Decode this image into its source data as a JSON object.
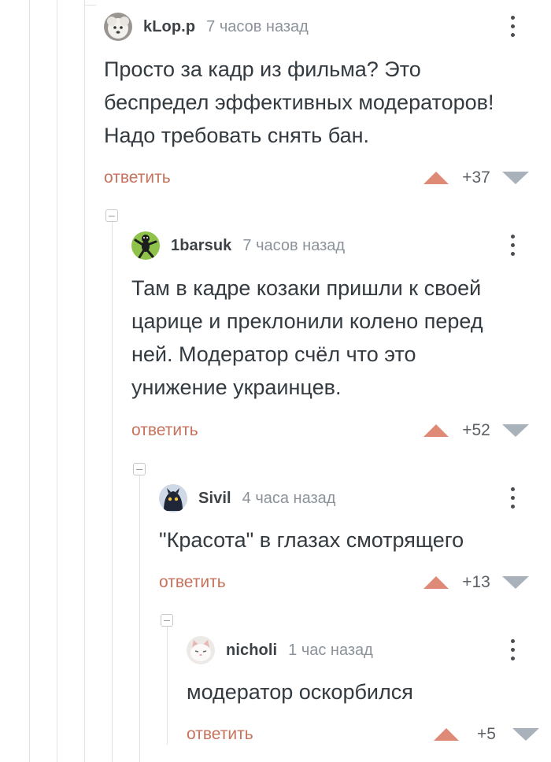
{
  "comments": [
    {
      "nick": "kLop.p",
      "time": "7 часов назад",
      "lines": [
        "Просто за кадр из фильма? Это",
        "беспредел эффективных модераторов!",
        "Надо требовать снять бан."
      ],
      "reply": "ответить",
      "score": "+37",
      "avatar_icon": "white-dog-avatar"
    },
    {
      "nick": "1barsuk",
      "time": "7 часов назад",
      "lines": [
        "Там в кадре козаки пришли к своей",
        "царице и преклонили колено перед",
        "ней. Модератор счёл что это",
        "унижение украинцев."
      ],
      "reply": "ответить",
      "score": "+52",
      "avatar_icon": "dancing-figure-avatar"
    },
    {
      "nick": "Sivil",
      "time": "4 часа назад",
      "lines": [
        "\"Красота\" в глазах смотрящего"
      ],
      "reply": "ответить",
      "score": "+13",
      "avatar_icon": "dark-creature-avatar"
    },
    {
      "nick": "nicholi",
      "time": "1 час назад",
      "lines": [
        "модератор оскорбился"
      ],
      "reply": "ответить",
      "score": "+5",
      "avatar_icon": "white-cat-avatar"
    }
  ],
  "colors": {
    "reply": "#c7725c",
    "upvote": "#df8a77",
    "downvote": "#a9b1bb",
    "thread_line": "#e3e3e3"
  }
}
